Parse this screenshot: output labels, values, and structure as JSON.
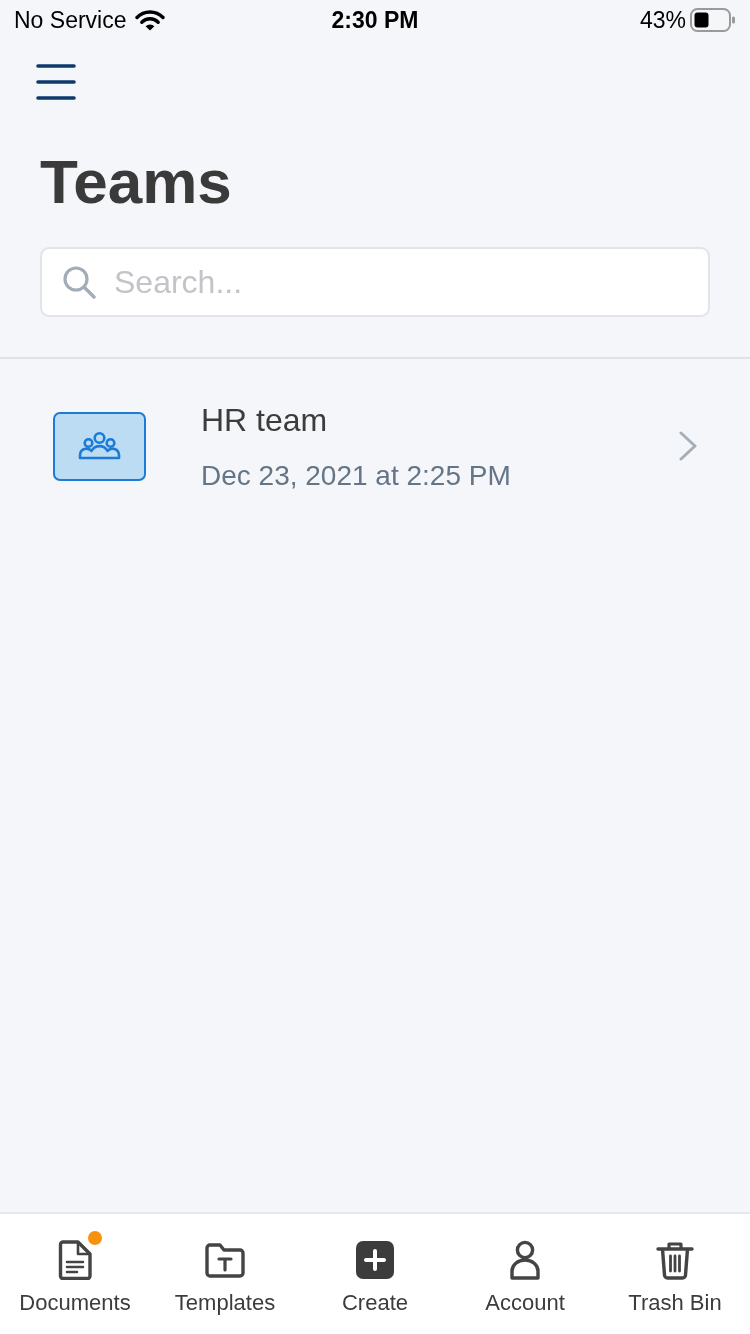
{
  "status_bar": {
    "carrier": "No Service",
    "time": "2:30 PM",
    "battery": "43%"
  },
  "header": {
    "title": "Teams"
  },
  "search": {
    "placeholder": "Search..."
  },
  "teams": [
    {
      "name": "HR team",
      "date": "Dec 23, 2021 at 2:25 PM"
    }
  ],
  "tab_bar": [
    {
      "kind": "documents",
      "label": "Documents",
      "notification": true
    },
    {
      "kind": "templates",
      "label": "Templates",
      "notification": false
    },
    {
      "kind": "create",
      "label": "Create",
      "notification": false
    },
    {
      "kind": "account",
      "label": "Account",
      "notification": false
    },
    {
      "kind": "trash",
      "label": "Trash Bin",
      "notification": false
    }
  ]
}
